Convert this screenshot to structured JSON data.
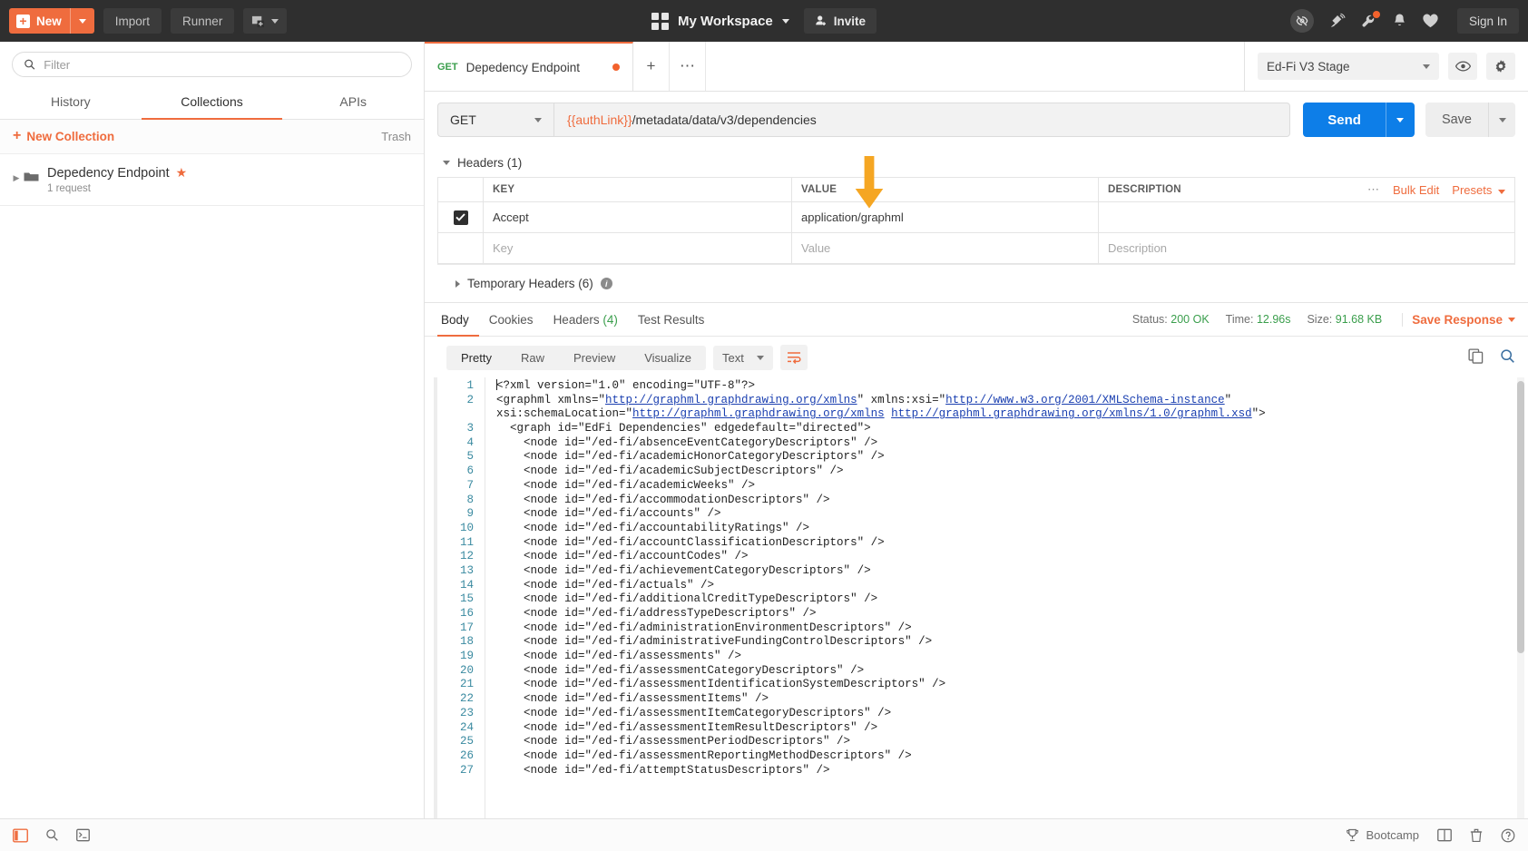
{
  "topbar": {
    "new_button": "New",
    "import_button": "Import",
    "runner_button": "Runner",
    "workspace_name": "My Workspace",
    "invite_button": "Invite",
    "signin_button": "Sign In"
  },
  "sidebar": {
    "filter_placeholder": "Filter",
    "tabs": [
      {
        "label": "History",
        "active": false
      },
      {
        "label": "Collections",
        "active": true
      },
      {
        "label": "APIs",
        "active": false
      }
    ],
    "new_collection_label": "New Collection",
    "trash_label": "Trash",
    "collections": [
      {
        "name": "Depedency Endpoint",
        "requests": "1 request",
        "starred": true
      }
    ]
  },
  "request": {
    "tab": {
      "method": "GET",
      "title": "Depedency Endpoint",
      "unsaved": true
    },
    "environment": "Ed-Fi V3 Stage",
    "method": "GET",
    "url_variable": "{{authLink}}",
    "url_path": "/metadata/data/v3/dependencies",
    "send_button": "Send",
    "save_button": "Save"
  },
  "headers": {
    "section_title": "Headers (1)",
    "columns": [
      "KEY",
      "VALUE",
      "DESCRIPTION"
    ],
    "rows": [
      {
        "enabled": true,
        "key": "Accept",
        "value": "application/graphml",
        "description": ""
      }
    ],
    "placeholder_row": {
      "key": "Key",
      "value": "Value",
      "description": "Description"
    },
    "bulk_edit_label": "Bulk Edit",
    "presets_label": "Presets",
    "temporary_headers": "Temporary Headers (6)"
  },
  "response": {
    "tabs": [
      {
        "label": "Body",
        "active": true
      },
      {
        "label": "Cookies",
        "active": false
      },
      {
        "label": "Headers",
        "count": "(4)",
        "active": false
      },
      {
        "label": "Test Results",
        "active": false
      }
    ],
    "status_label": "Status:",
    "status_value": "200 OK",
    "time_label": "Time:",
    "time_value": "12.96s",
    "size_label": "Size:",
    "size_value": "91.68 KB",
    "save_response_label": "Save Response",
    "view_modes": [
      {
        "label": "Pretty",
        "active": true
      },
      {
        "label": "Raw",
        "active": false
      },
      {
        "label": "Preview",
        "active": false
      },
      {
        "label": "Visualize",
        "active": false
      }
    ],
    "format": "Text",
    "body_lines": [
      {
        "n": 1,
        "text": "<?xml version=\"1.0\" encoding=\"UTF-8\"?>"
      },
      {
        "n": 2,
        "text": "<graphml xmlns=\"http://graphml.graphdrawing.org/xmlns\" xmlns:xsi=\"http://www.w3.org/2001/XMLSchema-instance\" xsi:schemaLocation=\"http://graphml.graphdrawing.org/xmlns http://graphml.graphdrawing.org/xmlns/1.0/graphml.xsd\">"
      },
      {
        "n": 3,
        "text": "  <graph id=\"EdFi Dependencies\" edgedefault=\"directed\">"
      },
      {
        "n": 4,
        "text": "    <node id=\"/ed-fi/absenceEventCategoryDescriptors\" />"
      },
      {
        "n": 5,
        "text": "    <node id=\"/ed-fi/academicHonorCategoryDescriptors\" />"
      },
      {
        "n": 6,
        "text": "    <node id=\"/ed-fi/academicSubjectDescriptors\" />"
      },
      {
        "n": 7,
        "text": "    <node id=\"/ed-fi/academicWeeks\" />"
      },
      {
        "n": 8,
        "text": "    <node id=\"/ed-fi/accommodationDescriptors\" />"
      },
      {
        "n": 9,
        "text": "    <node id=\"/ed-fi/accounts\" />"
      },
      {
        "n": 10,
        "text": "    <node id=\"/ed-fi/accountabilityRatings\" />"
      },
      {
        "n": 11,
        "text": "    <node id=\"/ed-fi/accountClassificationDescriptors\" />"
      },
      {
        "n": 12,
        "text": "    <node id=\"/ed-fi/accountCodes\" />"
      },
      {
        "n": 13,
        "text": "    <node id=\"/ed-fi/achievementCategoryDescriptors\" />"
      },
      {
        "n": 14,
        "text": "    <node id=\"/ed-fi/actuals\" />"
      },
      {
        "n": 15,
        "text": "    <node id=\"/ed-fi/additionalCreditTypeDescriptors\" />"
      },
      {
        "n": 16,
        "text": "    <node id=\"/ed-fi/addressTypeDescriptors\" />"
      },
      {
        "n": 17,
        "text": "    <node id=\"/ed-fi/administrationEnvironmentDescriptors\" />"
      },
      {
        "n": 18,
        "text": "    <node id=\"/ed-fi/administrativeFundingControlDescriptors\" />"
      },
      {
        "n": 19,
        "text": "    <node id=\"/ed-fi/assessments\" />"
      },
      {
        "n": 20,
        "text": "    <node id=\"/ed-fi/assessmentCategoryDescriptors\" />"
      },
      {
        "n": 21,
        "text": "    <node id=\"/ed-fi/assessmentIdentificationSystemDescriptors\" />"
      },
      {
        "n": 22,
        "text": "    <node id=\"/ed-fi/assessmentItems\" />"
      },
      {
        "n": 23,
        "text": "    <node id=\"/ed-fi/assessmentItemCategoryDescriptors\" />"
      },
      {
        "n": 24,
        "text": "    <node id=\"/ed-fi/assessmentItemResultDescriptors\" />"
      },
      {
        "n": 25,
        "text": "    <node id=\"/ed-fi/assessmentPeriodDescriptors\" />"
      },
      {
        "n": 26,
        "text": "    <node id=\"/ed-fi/assessmentReportingMethodDescriptors\" />"
      },
      {
        "n": 27,
        "text": "    <node id=\"/ed-fi/attemptStatusDescriptors\" />"
      }
    ]
  },
  "footer": {
    "bootcamp_label": "Bootcamp"
  },
  "colors": {
    "accent": "#ef6c3e",
    "send_blue": "#0d7ee8",
    "status_green": "#3a9e4c",
    "annotation_arrow": "#f5a623",
    "topbar_bg": "#2f2f2f"
  }
}
